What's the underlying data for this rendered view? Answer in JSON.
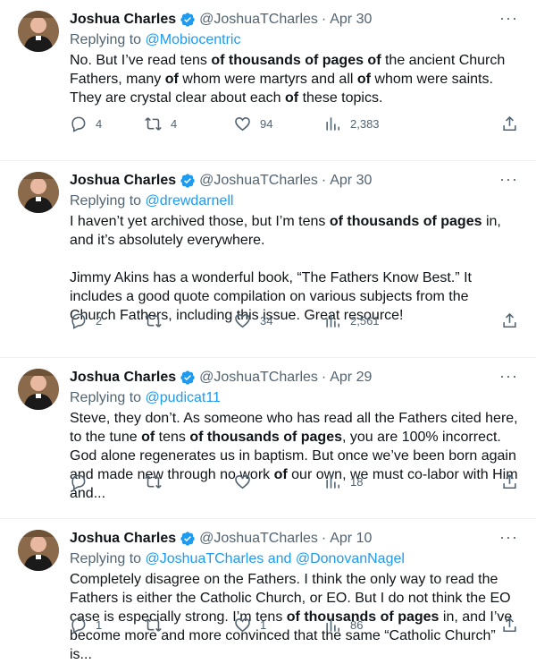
{
  "tweets": [
    {
      "name": "Joshua Charles",
      "handle": "@JoshuaTCharles",
      "date": "Apr 30",
      "replying_label": "Replying to",
      "replying_to": "@Mobiocentric",
      "segments": [
        {
          "t": "No. But I’ve read tens "
        },
        {
          "t": "of thousands of pages of",
          "b": true
        },
        {
          "t": " the ancient Church Fathers, many "
        },
        {
          "t": "of",
          "b": true
        },
        {
          "t": " whom were martyrs and all "
        },
        {
          "t": "of",
          "b": true
        },
        {
          "t": " whom were saints. They are crystal clear about each "
        },
        {
          "t": "of",
          "b": true
        },
        {
          "t": " these topics."
        }
      ],
      "replies": "4",
      "retweets": "4",
      "likes": "94",
      "views": "2,383"
    },
    {
      "name": "Joshua Charles",
      "handle": "@JoshuaTCharles",
      "date": "Apr 30",
      "replying_label": "Replying to",
      "replying_to": "@drewdarnell",
      "segments": [
        {
          "t": "I haven’t yet archived those, but I’m tens "
        },
        {
          "t": "of thousands of pages",
          "b": true
        },
        {
          "t": " in, and it’s absolutely everywhere.\n\nJimmy Akins has a wonderful book, “The Fathers Know Best.” It includes a good quote compilation on various subjects from the Church Fathers, including this issue. Great resource!"
        }
      ],
      "replies": "2",
      "retweets": "",
      "likes": "34",
      "views": "2,561"
    },
    {
      "name": "Joshua Charles",
      "handle": "@JoshuaTCharles",
      "date": "Apr 29",
      "replying_label": "Replying to",
      "replying_to": "@pudicat11",
      "segments": [
        {
          "t": "Steve, they don’t. As someone who has read all the Fathers cited here, to the tune "
        },
        {
          "t": "of",
          "b": true
        },
        {
          "t": " tens "
        },
        {
          "t": "of thousands of pages",
          "b": true
        },
        {
          "t": ", you are 100% incorrect. God alone regenerates us in baptism. But once we’ve been born again and made new through no work "
        },
        {
          "t": "of",
          "b": true
        },
        {
          "t": " our own, we must co-labor with Him and..."
        }
      ],
      "replies": "",
      "retweets": "",
      "likes": "",
      "views": "18"
    },
    {
      "name": "Joshua Charles",
      "handle": "@JoshuaTCharles",
      "date": "Apr 10",
      "replying_label": "Replying to",
      "replying_to": "@JoshuaTCharles and @DonovanNagel",
      "segments": [
        {
          "t": "Completely disagree on the Fathers. I think the only way to read the Fathers is either the Catholic Church, or EO. But I do not think the EO case is especially strong. I’m tens "
        },
        {
          "t": "of thousands of pages",
          "b": true
        },
        {
          "t": " in, and I’ve become more and more convinced that the same “Catholic Church” is..."
        }
      ],
      "replies": "1",
      "retweets": "",
      "likes": "1",
      "views": "86"
    }
  ],
  "icons": {
    "verified": "verified-badge-icon",
    "more": "more-options-icon",
    "reply": "reply-icon",
    "retweet": "retweet-icon",
    "like": "heart-icon",
    "views": "views-chart-icon",
    "share": "share-icon"
  },
  "colors": {
    "accent": "#1d9bf0",
    "secondary_text": "#536471",
    "primary_text": "#0f1419"
  }
}
